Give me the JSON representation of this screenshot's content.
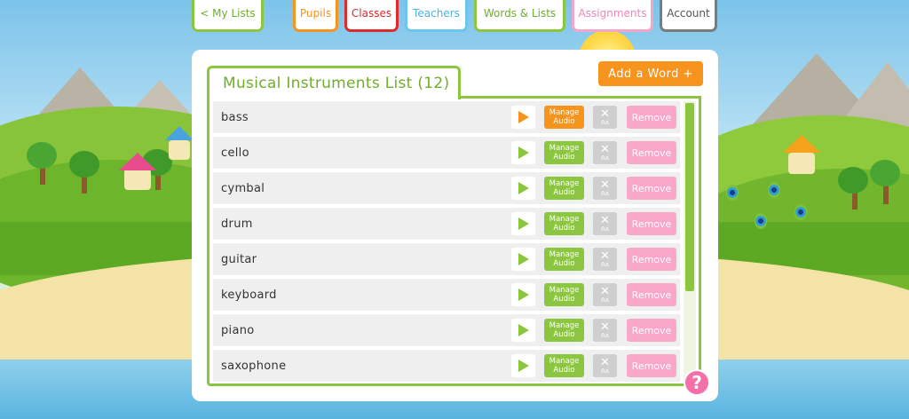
{
  "nav": {
    "my_lists": "< My Lists",
    "pupils": "Pupils",
    "classes": "Classes",
    "teachers": "Teachers",
    "words_lists": "Words & Lists",
    "assignments": "Assignments",
    "account": "Account"
  },
  "list": {
    "title": "Musical Instruments List (12)",
    "add_word_label": "Add a Word +",
    "manage_audio_label": "Manage Audio",
    "case_toggle_x": "✕",
    "case_toggle_aa": "Aa",
    "remove_label": "Remove",
    "rows": [
      {
        "word": "bass"
      },
      {
        "word": "cello"
      },
      {
        "word": "cymbal"
      },
      {
        "word": "drum"
      },
      {
        "word": "guitar"
      },
      {
        "word": "keyboard"
      },
      {
        "word": "piano"
      },
      {
        "word": "saxophone"
      }
    ]
  },
  "help": {
    "label": "?"
  },
  "colors": {
    "green": "#8cc63f",
    "orange": "#f7941d",
    "red": "#e02a2a",
    "blue": "#6ac6ee",
    "pink": "#f9a8c9",
    "grey": "#7b7b7b"
  }
}
